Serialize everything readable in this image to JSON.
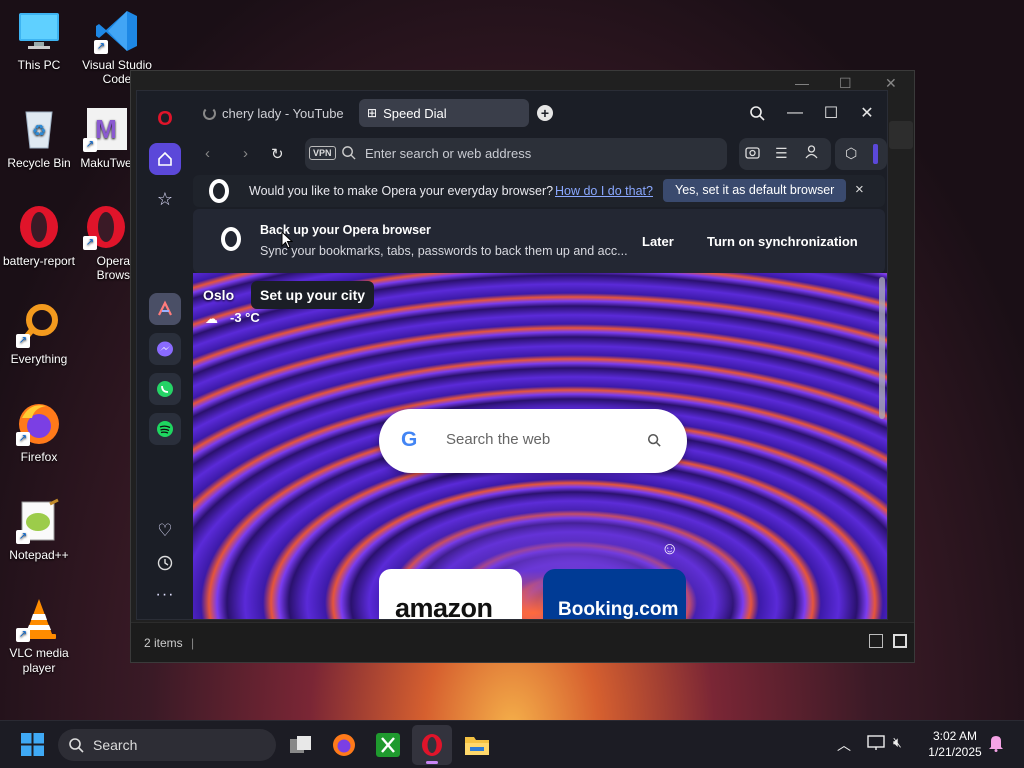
{
  "desktop": {
    "icons": [
      {
        "label": "This PC"
      },
      {
        "label": "Visual Studio Code"
      },
      {
        "label": "Recycle Bin"
      },
      {
        "label": "MakuTwe"
      },
      {
        "label": "battery-report"
      },
      {
        "label": "Opera Brows"
      },
      {
        "label": "Everything"
      },
      {
        "label": "Firefox"
      },
      {
        "label": "Notepad++"
      },
      {
        "label": "VLC media player"
      }
    ]
  },
  "explorer": {
    "status_items": "2 items"
  },
  "opera": {
    "tabs": [
      {
        "label": "chery lady - YouTube"
      },
      {
        "label": "Speed Dial"
      }
    ],
    "address": {
      "vpn_label": "VPN",
      "placeholder": "Enter search or web address"
    },
    "infobar": {
      "text": "Would you like to make Opera your everyday browser?",
      "link": "How do I do that?",
      "button": "Yes, set it as default browser",
      "close": "×"
    },
    "sync": {
      "title": "Back up your Opera browser",
      "body": "Sync your bookmarks, tabs, passwords to back them up and acc...",
      "later": "Later",
      "turn_on": "Turn on synchronization"
    },
    "weather": {
      "city": "Oslo",
      "setup": "Set up your city",
      "temp": "-3 °C"
    },
    "search": {
      "placeholder": "Search the web"
    },
    "tiles": [
      {
        "label": "amazon"
      },
      {
        "label": "Booking.com"
      }
    ]
  },
  "taskbar": {
    "search_label": "Search",
    "time": "3:02 AM",
    "date": "1/21/2025"
  },
  "colors": {
    "accent": "#7b5cff",
    "infobar_button": "#3a4a6e",
    "link": "#8aa8ff",
    "opera_red": "#e0142a"
  }
}
